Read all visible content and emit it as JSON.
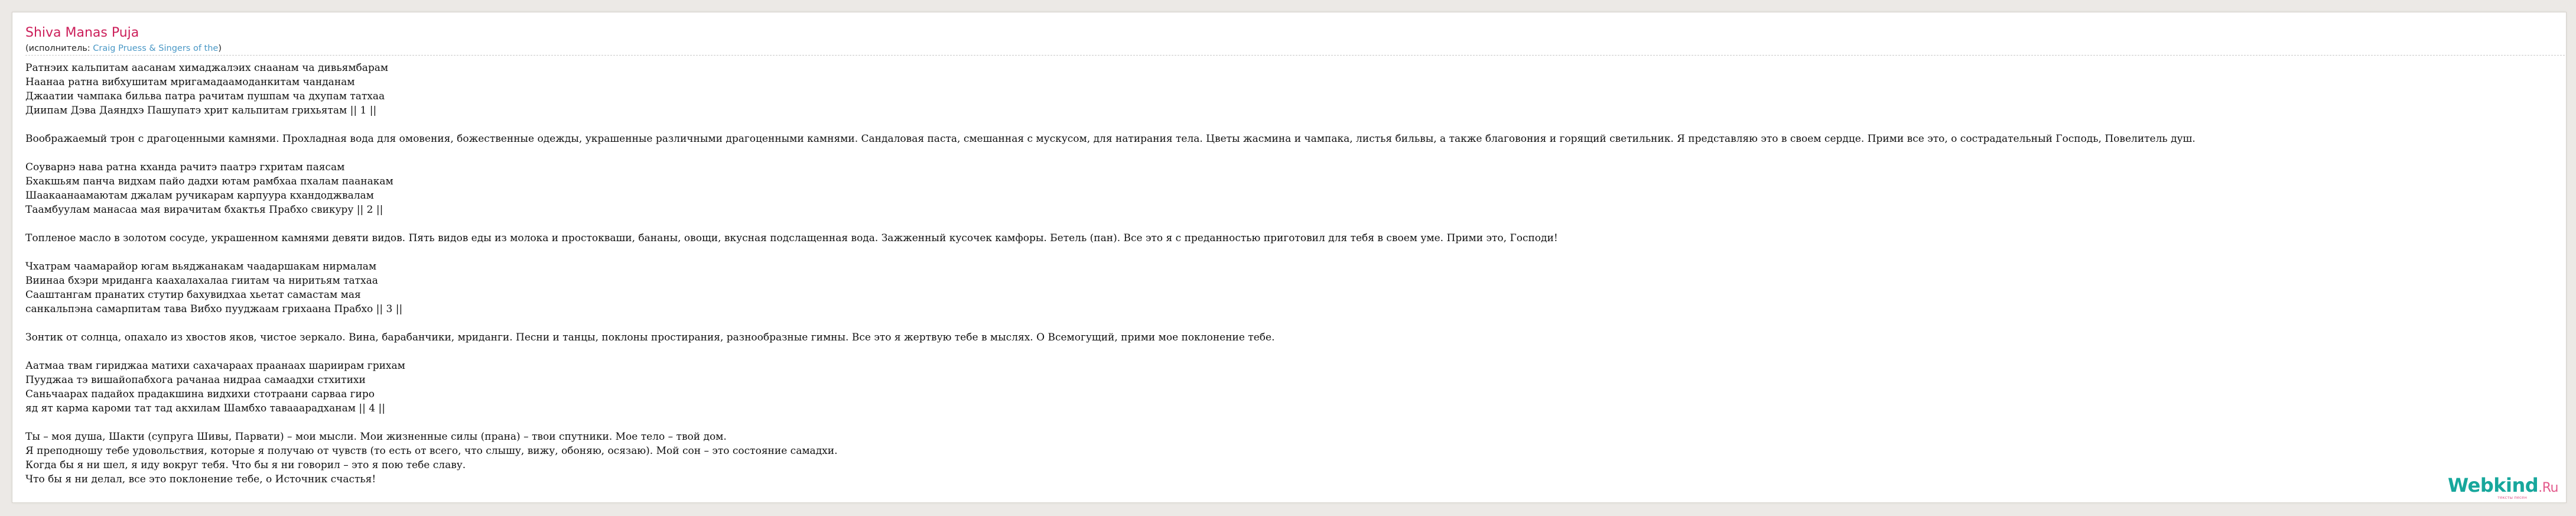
{
  "song": {
    "title": "Shiva Manas Puja",
    "performer_prefix": "(исполнитель: ",
    "performer_name": "Craig Pruess & Singers of the",
    "performer_suffix": ")"
  },
  "lyrics": {
    "lines": [
      "Ратнэих кальпитам аасанам химаджалэих снаанам ча дивьямбарам",
      "Наанаа ратна вибхушитам мригамадаамоданкитам чанданам",
      "Джаатии чампака бильва патра рачитам пушпам ча дхупам татхаа",
      "Диипам Дэва Даяндхэ Пашупатэ хрит кальпитам грихьятам || 1 ||",
      "",
      "Воображаемый трон с драгоценными камнями. Прохладная вода для омовения, божественные одежды, украшенные различными драгоценными камнями. Сандаловая паста, смешанная с мускусом, для натирания тела. Цветы жасмина и чампака, листья бильвы, а также благовония и горящий светильник. Я представляю это в своем сердце. Прими все это, о сострадательный Господь, Повелитель душ.",
      "",
      "Соуварнэ нава ратна кханда рачитэ паатрэ гхритам паясам",
      "Бхакшьям панча видхам пайо дадхи ютам рамбхаа пхалам паанакам",
      "Шаакаанаамаютам джалам ручикарам карпуура кхандоджвалам",
      "Таамбуулам манасаа мая вирачитам бхактья Прабхо свикуру || 2 ||",
      "",
      "Топленое масло в золотом сосуде, украшенном камнями девяти видов. Пять видов еды из молока и простокваши, бананы, овощи, вкусная подслащенная вода. Зажженный кусочек камфоры. Бетель (пан). Все это я с преданностью приготовил для тебя в своем уме. Прими это, Господи!",
      "",
      "Чхатрам чаамарайор югам вьяджанакам чаадаршакам нирмалам",
      "Виинаа бхэри мриданга каахалахалаа гиитам ча ниритьям татхаа",
      "Сааштангам пранатих стутир бахувидхаа хьетат самастам мая",
      "санкальпэна самарпитам тава Вибхо пууджаам грихаана Прабхо || 3 ||",
      "",
      "Зонтик от солнца, опахало из хвостов яков, чистое зеркало. Вина, барабанчики, мриданги. Песни и танцы, поклоны простирания, разнообразные гимны. Все это я жертвую тебе в мыслях. О Всемогущий, прими мое поклонение тебе.",
      "",
      "Аатмаа твам гириджаа матихи сахачараах праанаах шариирам грихам",
      "Пууджаа тэ вишайопабхога рачанаа нидраа самаадхи стхитихи",
      "Саньчаарах падайох прадакшина видхихи стотраани сарваа гиро",
      "яд ят карма кароми тат тад акхилам Шамбхо тавааарадханам || 4 ||",
      "",
      "Ты – моя душа, Шакти (супруга Шивы, Парвати) – мои мысли. Мои жизненные силы (прана) – твои спутники. Мое тело – твой дом.",
      "Я преподношу тебе удовольствия, которые я получаю от чувств (то есть от всего, что слышу, вижу, обоняю, осязаю). Мой сон – это состояние самадхи.",
      "Когда бы я ни шел, я иду вокруг тебя. Что бы я ни говорил – это я пою тебе славу.",
      "Что бы я ни делал, все это поклонение тебе, о Источник счастья!"
    ]
  },
  "brand": {
    "name": "Webkind",
    "suffix": ".Ru",
    "tagline": "тексты песен"
  },
  "colors": {
    "title": "#cc1f5a",
    "link": "#4a98c6",
    "brand": "#17a79c",
    "brand_accent": "#e35a8c",
    "background": "#ece9e6"
  }
}
